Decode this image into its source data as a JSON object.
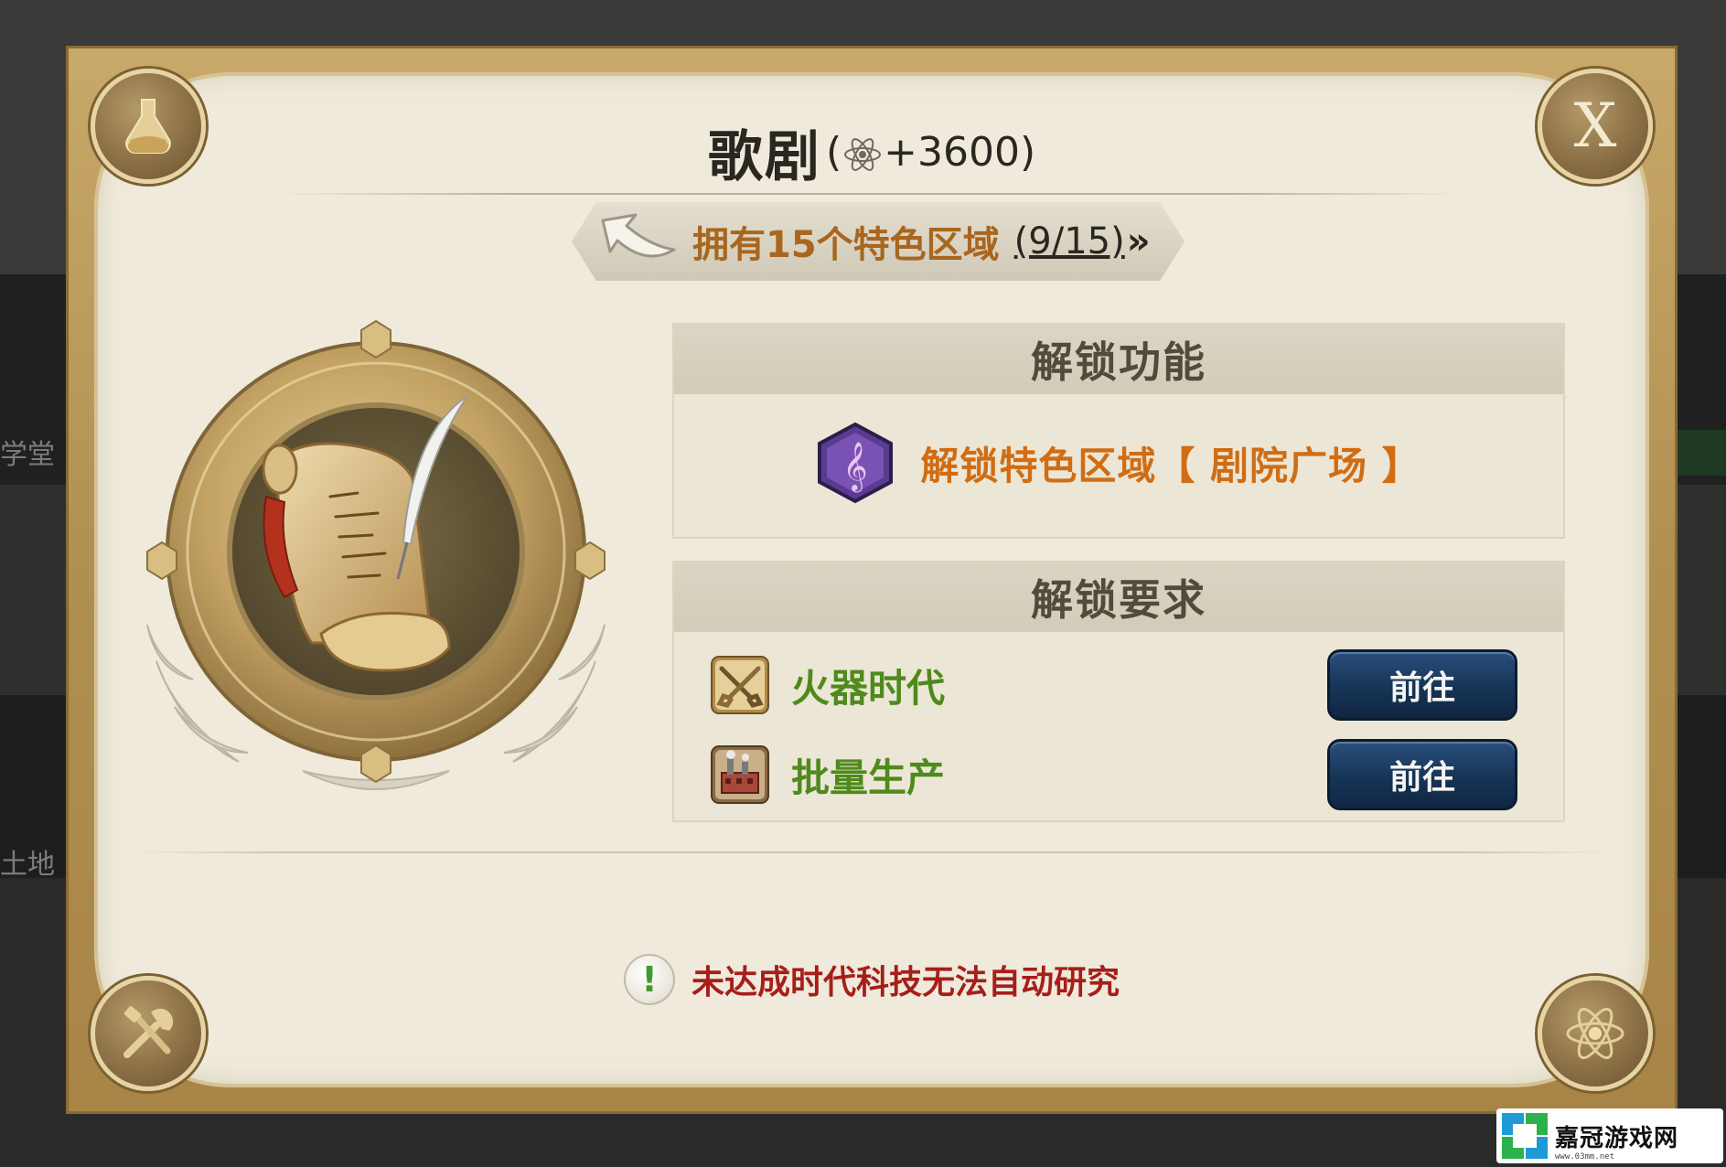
{
  "background": {
    "labels": [
      "学堂",
      "土地"
    ]
  },
  "dialog": {
    "title": "歌剧",
    "bonus": "+3600",
    "bonus_open": "(",
    "bonus_close": ")",
    "close_label": "X",
    "achievement": {
      "text": "拥有15个特色区域",
      "progress": "(9/15)",
      "chevrons": "»"
    },
    "unlock_section": {
      "heading": "解锁功能",
      "feature": "解锁特色区域【 剧院广场 】"
    },
    "requirements_section": {
      "heading": "解锁要求",
      "items": [
        {
          "name": "火器时代",
          "button": "前往",
          "icon": "crossed-pistols-icon"
        },
        {
          "name": "批量生产",
          "button": "前往",
          "icon": "factory-icon"
        }
      ]
    },
    "warning": {
      "icon": "!",
      "text": "未达成时代科技无法自动研究"
    },
    "corner_icons": [
      "flask-icon",
      "close-icon",
      "tools-icon",
      "atom-icon"
    ]
  },
  "watermark": {
    "text": "嘉冠游戏网",
    "url": "www.03mm.net"
  },
  "colors": {
    "frame_gold": "#b08f52",
    "parchment": "#efeadb",
    "achievement_orange": "#a8661e",
    "feature_orange": "#d06d14",
    "requirement_green": "#4f8a1c",
    "button_navy": "#163455",
    "warning_red": "#a61e1a"
  }
}
